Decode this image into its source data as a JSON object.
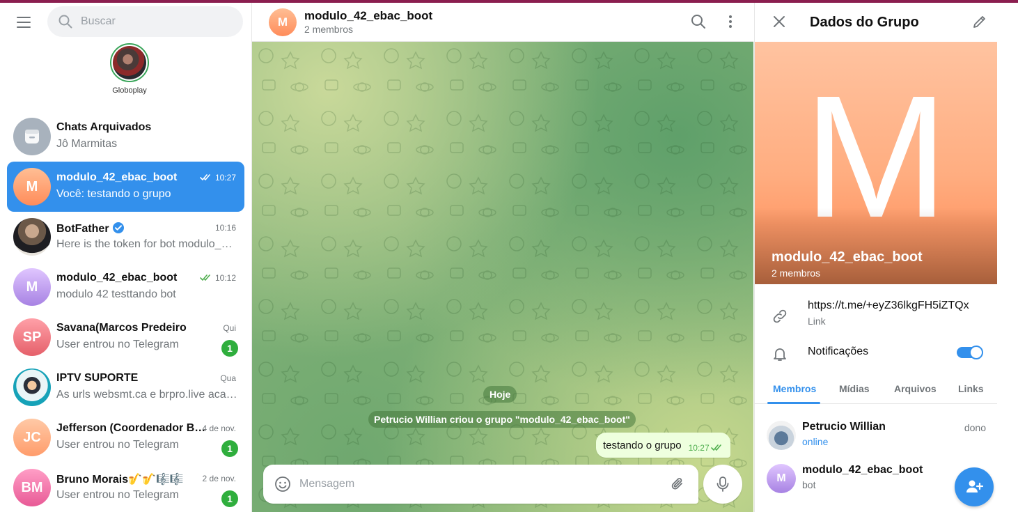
{
  "colors": {
    "accent": "#3390ec",
    "unread": "#2fae3d",
    "bubble": "#eeffde"
  },
  "sidebar": {
    "search_placeholder": "Buscar",
    "story": {
      "label": "Globoplay"
    },
    "chats": [
      {
        "name": "Chats Arquivados",
        "sub": "Jô Marmitas",
        "time": "",
        "avatar": "archive-icon"
      },
      {
        "name": "modulo_42_ebac_boot",
        "sub": "Você: testando o grupo",
        "time": "10:27",
        "initials": "M",
        "active": true
      },
      {
        "name": "BotFather",
        "sub": "Here is the token for bot modulo_4…",
        "time": "10:16"
      },
      {
        "name": "modulo_42_ebac_boot",
        "sub": "modulo 42 testtando bot",
        "time": "10:12",
        "initials": "M"
      },
      {
        "name": "Savana(Marcos Predeiro",
        "sub": "User entrou no Telegram",
        "time": "Qui",
        "initials": "SP",
        "unread": "1"
      },
      {
        "name": "IPTV SUPORTE",
        "sub": "As urls websmt.ca e brpro.live aca…",
        "time": "Qua"
      },
      {
        "name": "Jefferson (Coordenador B…",
        "sub": "User entrou no Telegram",
        "time": "4 de nov.",
        "initials": "JC",
        "unread": "1"
      },
      {
        "name": "Bruno Morais🎷🎷🎼🎼",
        "sub": "User entrou no Telegram",
        "time": "2 de nov.",
        "initials": "BM",
        "unread": "1"
      }
    ]
  },
  "chat": {
    "title": "modulo_42_ebac_boot",
    "subtitle": "2 membros",
    "initial": "M",
    "date_chip": "Hoje",
    "service_message": "Petrucio Willian criou o grupo \"modulo_42_ebac_boot\"",
    "message": {
      "text": "testando o grupo",
      "time": "10:27"
    },
    "composer_placeholder": "Mensagem"
  },
  "info": {
    "title": "Dados do Grupo",
    "cover_letter": "M",
    "name": "modulo_42_ebac_boot",
    "members_count": "2 membros",
    "link": "https://t.me/+eyZ36lkgFH5iZTQx",
    "link_label": "Link",
    "notifications_label": "Notificações",
    "notifications_on": true,
    "tabs": [
      "Membros",
      "Mídias",
      "Arquivos",
      "Links"
    ],
    "members": [
      {
        "name": "Petrucio Willian",
        "status": "online",
        "role": "dono"
      },
      {
        "name": "modulo_42_ebac_boot",
        "status": "bot",
        "role": "",
        "initials": "M"
      }
    ]
  }
}
